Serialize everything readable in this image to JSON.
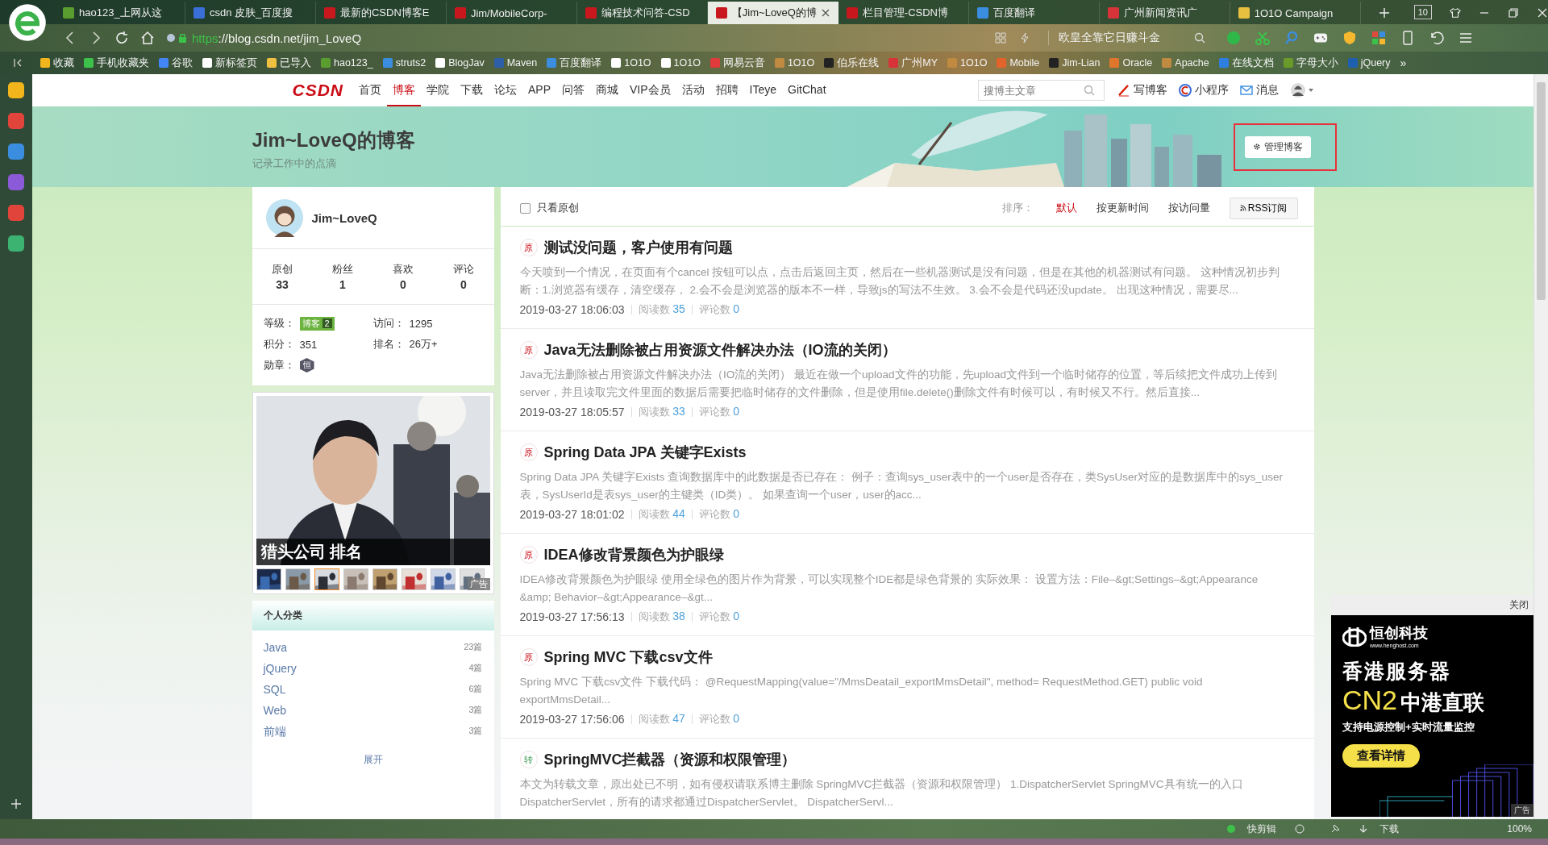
{
  "browser": {
    "tabs": [
      {
        "title": "hao123_上网从这",
        "selected": false,
        "color": "#5a9e2f"
      },
      {
        "title": "csdn 皮肤_百度搜",
        "selected": false,
        "color": "#3b6fd8"
      },
      {
        "title": "最新的CSDN博客E",
        "selected": false,
        "color": "#c9171e"
      },
      {
        "title": "Jim/MobileCorp-",
        "selected": false,
        "color": "#c9171e"
      },
      {
        "title": "编程技术问答-CSD",
        "selected": false,
        "color": "#c9171e"
      },
      {
        "title": "【Jim~LoveQ的博",
        "selected": true,
        "color": "#c9171e"
      },
      {
        "title": "栏目管理-CSDN博",
        "selected": false,
        "color": "#c9171e"
      },
      {
        "title": "百度翻译",
        "selected": false,
        "color": "#3b8de0"
      },
      {
        "title": "广州新闻资讯广",
        "selected": false,
        "color": "#d9333a"
      },
      {
        "title": "1O1O Campaign",
        "selected": false,
        "color": "#e8c040"
      }
    ],
    "tab_count": "10",
    "url_scheme": "https",
    "url_rest": "://blog.csdn.net/jim_LoveQ",
    "search_text": "欧皇全靠它日赚斗金",
    "bookmarks": [
      {
        "label": "收藏",
        "color": "#f2b51c"
      },
      {
        "label": "手机收藏夹",
        "color": "#3cc24a"
      },
      {
        "label": "谷歌",
        "color": "#4285f4"
      },
      {
        "label": "新标签页",
        "color": "#ffffff"
      },
      {
        "label": "已导入",
        "color": "#f0c040"
      },
      {
        "label": "hao123_",
        "color": "#5a9e2f"
      },
      {
        "label": "struts2",
        "color": "#3b8de0"
      },
      {
        "label": "BlogJav",
        "color": "#ffffff"
      },
      {
        "label": "Maven",
        "color": "#2d5fa8"
      },
      {
        "label": "百度翻译",
        "color": "#3b8de0"
      },
      {
        "label": "1O1O",
        "color": "#ffffff"
      },
      {
        "label": "1O1O",
        "color": "#ffffff"
      },
      {
        "label": "网易云音",
        "color": "#e03a3a"
      },
      {
        "label": "1O1O",
        "color": "#c08a40"
      },
      {
        "label": "伯乐在线",
        "color": "#222222"
      },
      {
        "label": "广州MY",
        "color": "#d9333a"
      },
      {
        "label": "1O1O",
        "color": "#c08a40"
      },
      {
        "label": "Mobile",
        "color": "#e2632b"
      },
      {
        "label": "Jim-Lian",
        "color": "#222222"
      },
      {
        "label": "Oracle",
        "color": "#e0762b"
      },
      {
        "label": "Apache",
        "color": "#c08a40"
      },
      {
        "label": "在线文档",
        "color": "#2f7fe0"
      },
      {
        "label": "字母大小",
        "color": "#6a9a2a"
      },
      {
        "label": "jQuery",
        "color": "#1f5fb0"
      }
    ],
    "more": "»",
    "status": {
      "clip": "快剪辑",
      "download": "下载",
      "zoom": "100%"
    }
  },
  "csdn": {
    "logo": "CSDN",
    "nav": [
      {
        "label": "首页",
        "selected": false
      },
      {
        "label": "博客",
        "selected": true
      },
      {
        "label": "学院",
        "selected": false
      },
      {
        "label": "下载",
        "selected": false
      },
      {
        "label": "论坛",
        "selected": false
      },
      {
        "label": "APP",
        "selected": false
      },
      {
        "label": "问答",
        "selected": false
      },
      {
        "label": "商城",
        "selected": false
      },
      {
        "label": "VIP会员",
        "selected": false
      },
      {
        "label": "活动",
        "selected": false
      },
      {
        "label": "招聘",
        "selected": false
      },
      {
        "label": "ITeye",
        "selected": false
      },
      {
        "label": "GitChat",
        "selected": false
      }
    ],
    "search_placeholder": "搜博主文章",
    "actions": [
      {
        "label": "写博客",
        "kind": "write"
      },
      {
        "label": "小程序",
        "kind": "mini"
      },
      {
        "label": "消息",
        "kind": "mail"
      }
    ]
  },
  "banner": {
    "title": "Jim~LoveQ的博客",
    "subtitle": "记录工作中的点滴",
    "manage": "管理博客",
    "highlighted": true
  },
  "profile": {
    "name": "Jim~LoveQ",
    "stats": [
      {
        "label": "原创",
        "value": "33"
      },
      {
        "label": "粉丝",
        "value": "1"
      },
      {
        "label": "喜欢",
        "value": "0"
      },
      {
        "label": "评论",
        "value": "0"
      }
    ],
    "level_label": "等级：",
    "level_badge": "博客",
    "level_num": "2",
    "visits_label": "访问：",
    "visits": "1295",
    "points_label": "积分：",
    "points": "351",
    "rank_label": "排名：",
    "rank": "26万+",
    "medal_label": "勋章：",
    "medal": "恒"
  },
  "side_ad": {
    "caption": "猎头公司 排名",
    "tag": "广告"
  },
  "categories": {
    "title": "个人分类",
    "items": [
      {
        "name": "Java",
        "count": "23篇"
      },
      {
        "name": "jQuery",
        "count": "4篇"
      },
      {
        "name": "SQL",
        "count": "6篇"
      },
      {
        "name": "Web",
        "count": "3篇"
      },
      {
        "name": "前端",
        "count": "3篇"
      }
    ],
    "expand": "展开"
  },
  "list_bar": {
    "only_original": "只看原创",
    "checked": false,
    "sort_label": "排序：",
    "sort": [
      {
        "label": "默认",
        "selected": true
      },
      {
        "label": "按更新时间",
        "selected": false
      },
      {
        "label": "按访问量",
        "selected": false
      }
    ],
    "rss": "RSS订阅"
  },
  "articles": [
    {
      "kind": "original",
      "tag": "原",
      "title": "测试没问题，客户使用有问题",
      "summary": "今天喷到一个情况，在页面有个cancel 按钮可以点，点击后返回主页，然后在一些机器测试是没有问题，但是在其他的机器测试有问题。 这种情况初步判断：1.浏览器有缓存，清空缓存， 2.会不会是浏览器的版本不一样，导致js的写法不生效。 3.会不会是代码还没update。 出现这种情况，需要尽...",
      "date": "2019-03-27 18:06:03",
      "reads_label": "阅读数",
      "reads": "35",
      "comments_label": "评论数",
      "comments": "0"
    },
    {
      "kind": "original",
      "tag": "原",
      "title": "Java无法删除被占用资源文件解决办法（IO流的关闭）",
      "summary": "Java无法删除被占用资源文件解决办法（IO流的关闭） 最近在做一个upload文件的功能，先upload文件到一个临时储存的位置，等后续把文件成功上传到server，并且读取完文件里面的数据后需要把临时储存的文件删除，但是使用file.delete()删除文件有时候可以，有时候又不行。然后直接...",
      "date": "2019-03-27 18:05:57",
      "reads_label": "阅读数",
      "reads": "33",
      "comments_label": "评论数",
      "comments": "0"
    },
    {
      "kind": "original",
      "tag": "原",
      "title": "Spring Data JPA 关键字Exists",
      "summary": "Spring Data JPA 关键字Exists 查询数据库中的此数据是否已存在： 例子：查询sys_user表中的一个user是否存在，类SysUser对应的是数据库中的sys_user表，SysUserId是表sys_user的主键类（ID类）。 如果查询一个user，user的acc...",
      "date": "2019-03-27 18:01:02",
      "reads_label": "阅读数",
      "reads": "44",
      "comments_label": "评论数",
      "comments": "0"
    },
    {
      "kind": "original",
      "tag": "原",
      "title": "IDEA修改背景颜色为护眼绿",
      "summary": "IDEA修改背景颜色为护眼绿 使用全绿色的图片作为背景，可以实现整个IDE都是绿色背景的 实际效果： 设置方法：File–&gt;Settings–&gt;Appearance &amp; Behavior–&gt;Appearance–&gt...",
      "date": "2019-03-27 17:56:13",
      "reads_label": "阅读数",
      "reads": "38",
      "comments_label": "评论数",
      "comments": "0"
    },
    {
      "kind": "original",
      "tag": "原",
      "title": "Spring MVC 下载csv文件",
      "summary": "Spring MVC 下载csv文件 下载代码： @RequestMapping(value=\"/MmsDeatail_exportMmsDetail\", method= RequestMethod.GET) public void exportMmsDetail...",
      "date": "2019-03-27 17:56:06",
      "reads_label": "阅读数",
      "reads": "47",
      "comments_label": "评论数",
      "comments": "0"
    },
    {
      "kind": "repost",
      "tag": "转",
      "title": "SpringMVC拦截器（资源和权限管理）",
      "summary": "本文为转载文章，原出处已不明，如有侵权请联系博主删除 SpringMVC拦截器（资源和权限管理） 1.DispatcherServlet SpringMVC具有统一的入口DispatcherServlet，所有的请求都通过DispatcherServlet。 DispatcherServl..."
    }
  ],
  "float_ad": {
    "close": "关闭",
    "brand": "恒创科技",
    "site": "www.henghost.com",
    "line1": "香港服务器",
    "cn2": "CN2",
    "line2": "中港直联",
    "line3": "支持电源控制+实时流量监控",
    "cta": "查看详情",
    "tag": "广告"
  }
}
